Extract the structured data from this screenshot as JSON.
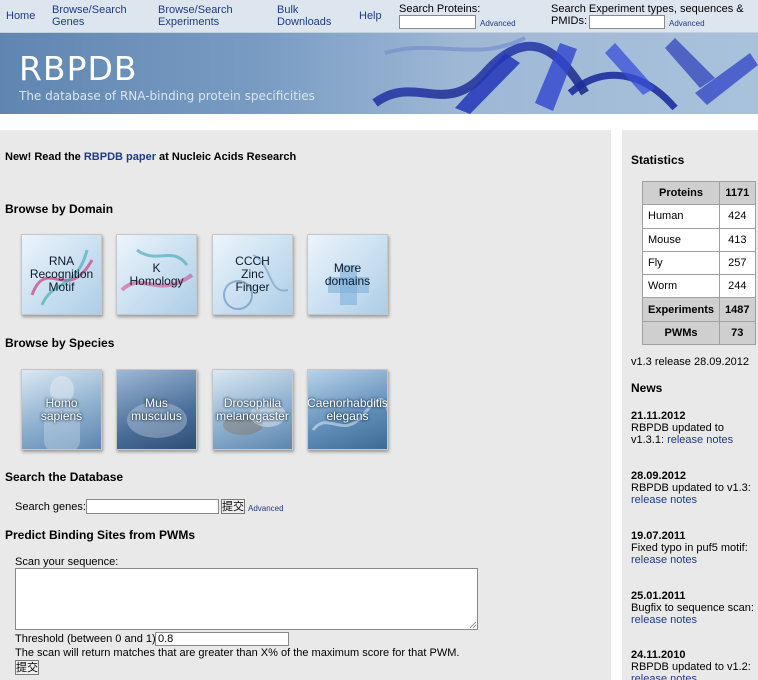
{
  "nav": {
    "items": [
      "Home",
      "Browse/Search\nGenes",
      "Browse/Search\nExperiments",
      "Bulk\nDownloads",
      "Help"
    ],
    "search_proteins_label": "Search Proteins:",
    "search_proteins_advanced": "Advanced",
    "search_experiments_label_line1": "Search Experiment types, sequences &",
    "search_experiments_label_line2": "PMIDs:",
    "search_experiments_advanced": "Advanced"
  },
  "banner": {
    "title": "RBPDB",
    "subtitle": "The database of RNA-binding protein specificities"
  },
  "main": {
    "announce_prefix": "New! Read the ",
    "announce_link": "RBPDB paper",
    "announce_suffix": " at Nucleic Acids Research",
    "browse_domain_heading": "Browse by Domain",
    "domain_tiles": [
      {
        "label": "RNA\nRecognition\nMotif"
      },
      {
        "label": "K\nHomology"
      },
      {
        "label": "CCCH\nZinc\nFinger"
      },
      {
        "label": "More\ndomains"
      }
    ],
    "browse_species_heading": "Browse by Species",
    "species_tiles": [
      {
        "label": "Homo\nsapiens"
      },
      {
        "label": "Mus\nmusculus"
      },
      {
        "label": "Drosophila\nmelanogaster"
      },
      {
        "label": "Caenorhabditis\nelegans"
      }
    ],
    "search_heading": "Search the Database",
    "search_genes_label": "Search genes:",
    "search_submit": "提交",
    "search_advanced": "Advanced",
    "predict_heading": "Predict Binding Sites from PWMs",
    "scan_label": "Scan your sequence:",
    "threshold_label": "Threshold (between 0 and 1):",
    "threshold_value": "0.8",
    "scan_note": "The scan will return matches that are greater than X% of the maximum score for that PWM.",
    "scan_submit": "提交"
  },
  "sidebar": {
    "statistics_heading": "Statistics",
    "stats": [
      {
        "label": "Proteins",
        "value": "1171",
        "header": true
      },
      {
        "label": "Human",
        "value": "424",
        "header": false
      },
      {
        "label": "Mouse",
        "value": "413",
        "header": false
      },
      {
        "label": "Fly",
        "value": "257",
        "header": false
      },
      {
        "label": "Worm",
        "value": "244",
        "header": false
      },
      {
        "label": "Experiments",
        "value": "1487",
        "header": true
      },
      {
        "label": "PWMs",
        "value": "73",
        "header": true
      }
    ],
    "release": "v1.3 release 28.09.2012",
    "news_heading": "News",
    "news": [
      {
        "date": "21.11.2012",
        "text": "RBPDB updated to\nv1.3.1: ",
        "link": "release notes"
      },
      {
        "date": "28.09.2012",
        "text": "RBPDB updated to v1.3:\n",
        "link": "release notes"
      },
      {
        "date": "19.07.2011",
        "text": "Fixed typo in puf5 motif:\n",
        "link": "release notes"
      },
      {
        "date": "25.01.2011",
        "text": "Bugfix to sequence scan:\n",
        "link": "release notes"
      },
      {
        "date": "24.11.2010",
        "text": "RBPDB updated to v1.2:\n",
        "link": "release notes"
      }
    ]
  },
  "colors": {
    "link": "#1f3b87",
    "panel_bg": "#e9e9e9",
    "nav_bg": "#dde5ee",
    "stats_header_bg": "#cfcfcf"
  }
}
